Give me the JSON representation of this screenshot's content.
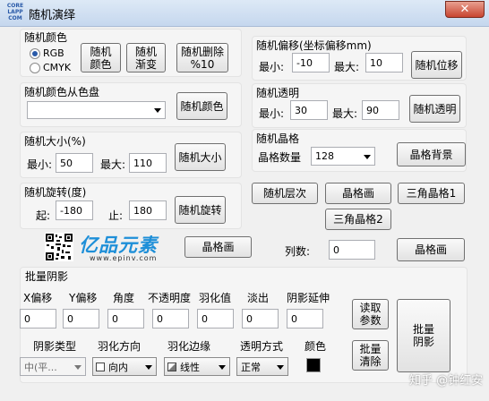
{
  "window": {
    "title": "随机演绎",
    "close": "✕",
    "app_logo": "CORE LAPP COM"
  },
  "g1": {
    "title": "随机颜色",
    "rgb": "RGB",
    "cmyk": "CMYK",
    "btn_color": "随机\n颜色",
    "btn_gradient": "随机\n渐变",
    "btn_delete": "随机删除\n%10"
  },
  "g2": {
    "title": "随机颜色从色盘",
    "btn": "随机颜色"
  },
  "g3": {
    "title": "随机大小(%)",
    "min_label": "最小:",
    "min": "50",
    "max_label": "最大:",
    "max": "110",
    "btn": "随机大小"
  },
  "g4": {
    "title": "随机旋转(度)",
    "start_label": "起:",
    "start": "-180",
    "end_label": "止:",
    "end": "180",
    "btn": "随机旋转"
  },
  "g5": {
    "title": "随机偏移(坐标偏移mm)",
    "min_label": "最小:",
    "min": "-10",
    "max_label": "最大:",
    "max": "10",
    "btn": "随机位移"
  },
  "g6": {
    "title": "随机透明",
    "min_label": "最小:",
    "min": "30",
    "max_label": "最大:",
    "max": "90",
    "btn": "随机透明"
  },
  "g7": {
    "title": "随机晶格",
    "count_label": "晶格数量",
    "count": "128",
    "btn": "晶格背景"
  },
  "mid": {
    "layer": "随机层次",
    "grid": "晶格画",
    "tri1": "三角晶格1",
    "tri2": "三角晶格2"
  },
  "logo": {
    "text": "亿品元素",
    "url": "www.epinv.com"
  },
  "row": {
    "grid_btn": "晶格画",
    "cols_label": "列数:",
    "cols": "0",
    "grid_btn2": "晶格画"
  },
  "shadow": {
    "title": "批量阴影",
    "labels": [
      "X偏移",
      "Y偏移",
      "角度",
      "不透明度",
      "羽化值",
      "淡出",
      "阴影延伸"
    ],
    "values": [
      "0",
      "0",
      "0",
      "0",
      "0",
      "0",
      "0"
    ],
    "type_label": "阴影类型",
    "type_val": "中(平...",
    "dir_label": "羽化方向",
    "dir_val": "向内",
    "edge_label": "羽化边缘",
    "edge_val": "线性",
    "mode_label": "透明方式",
    "mode_val": "正常",
    "color_label": "颜色",
    "btn_read": "读取\n参数",
    "btn_clear": "批量\n清除",
    "btn_batch": "批量\n阴影"
  },
  "watermark": "知乎 @钟红安",
  "colors": {
    "accent": "#2a5aa8",
    "shadow_color": "#000000"
  }
}
